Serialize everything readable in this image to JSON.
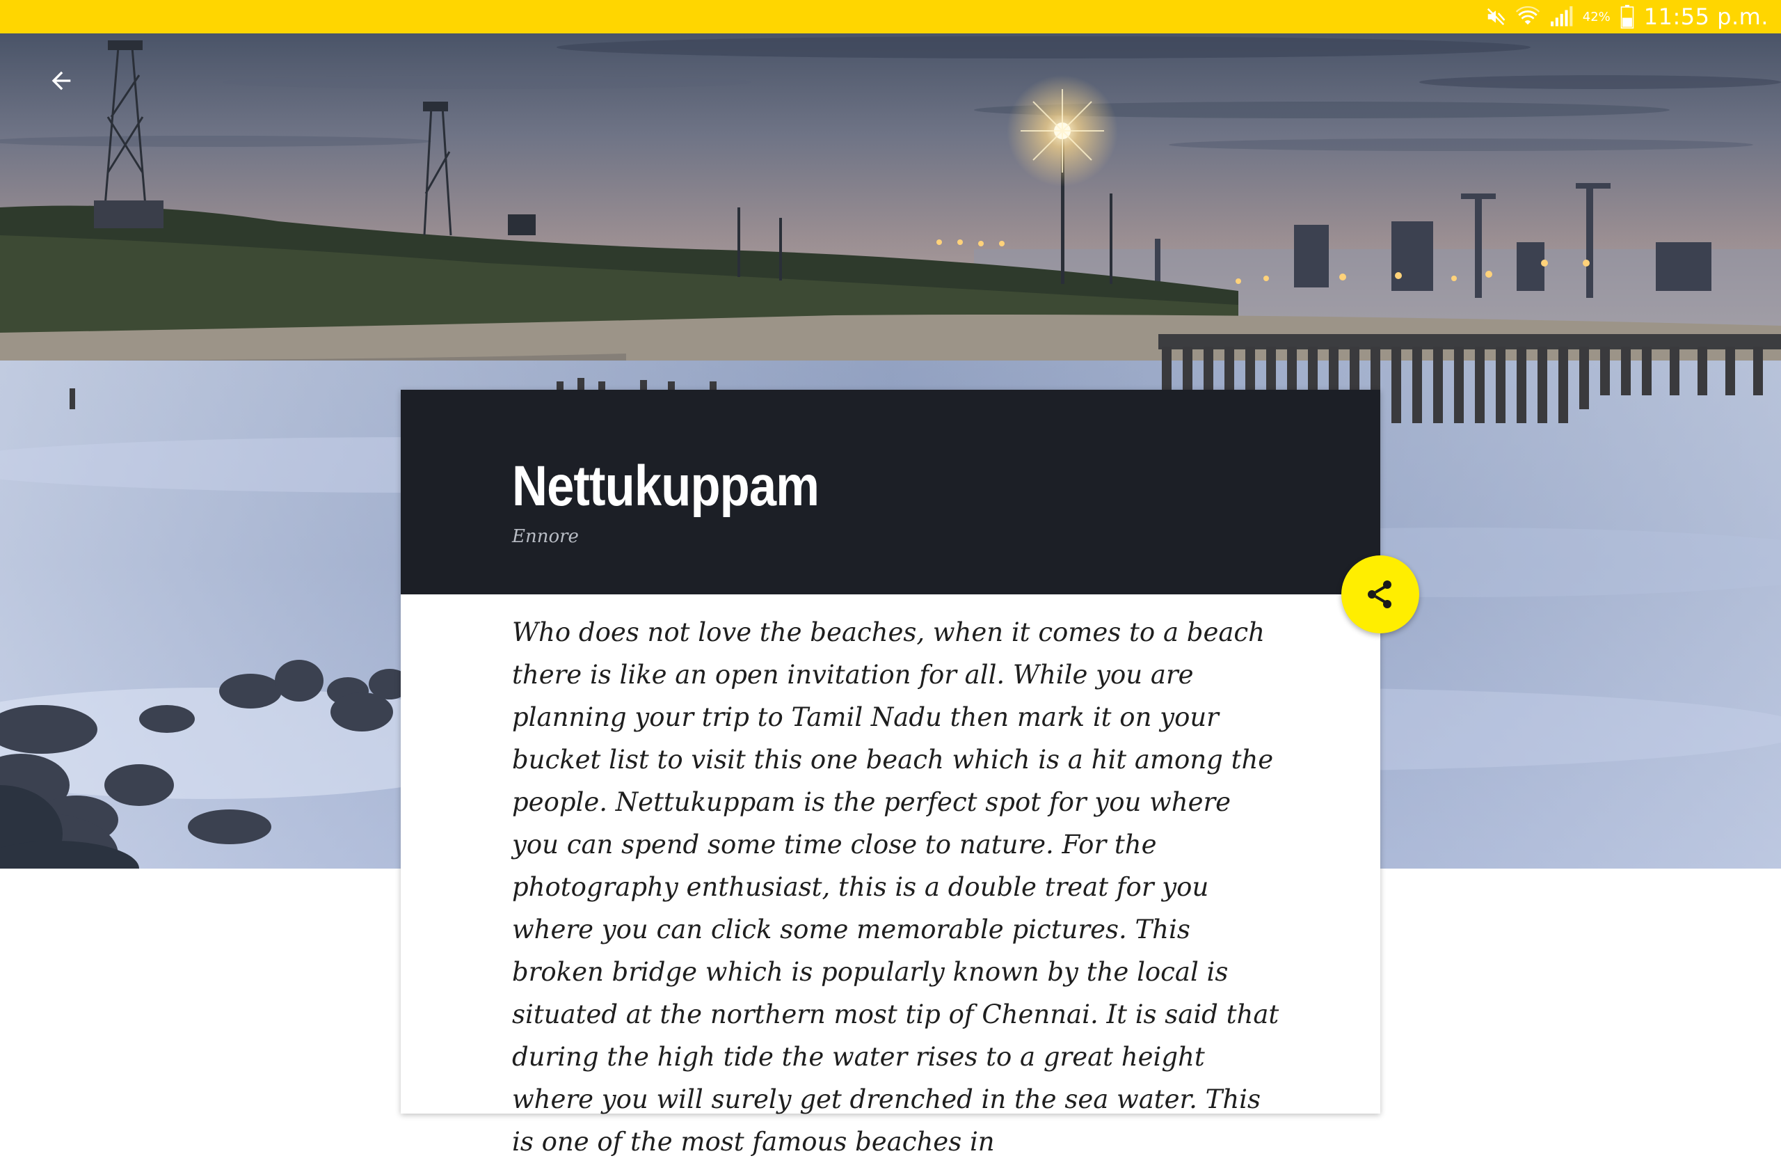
{
  "status_bar": {
    "battery_percent": "42%",
    "time": "11:55 p.m.",
    "icons": [
      "mute-icon",
      "wifi-icon",
      "signal-icon",
      "battery-icon"
    ],
    "background_color": "#FFD600"
  },
  "header": {
    "back_icon": "arrow-left-icon"
  },
  "place": {
    "title": "Nettukuppam",
    "location": "Ennore",
    "description": "Who does not love the beaches, when it comes to a beach there is like an open invitation for all. While you are planning your trip to Tamil Nadu then mark it on your bucket list to visit this one beach which is a hit among the people. Nettukuppam is the perfect spot for you where you can spend some time close to nature. For the photography enthusiast, this is a double treat for you where you can click some memorable pictures. This broken bridge which is popularly known by the local is situated at the northern most tip of Chennai. It is said that during the high tide the water rises to a great height where you will surely get drenched in the sea water. This is one of the most famous beaches in"
  },
  "share_button": {
    "icon": "share-icon",
    "color": "#FFEE00"
  },
  "colors": {
    "card_header": "#1C1F26",
    "accent": "#FFD600"
  }
}
